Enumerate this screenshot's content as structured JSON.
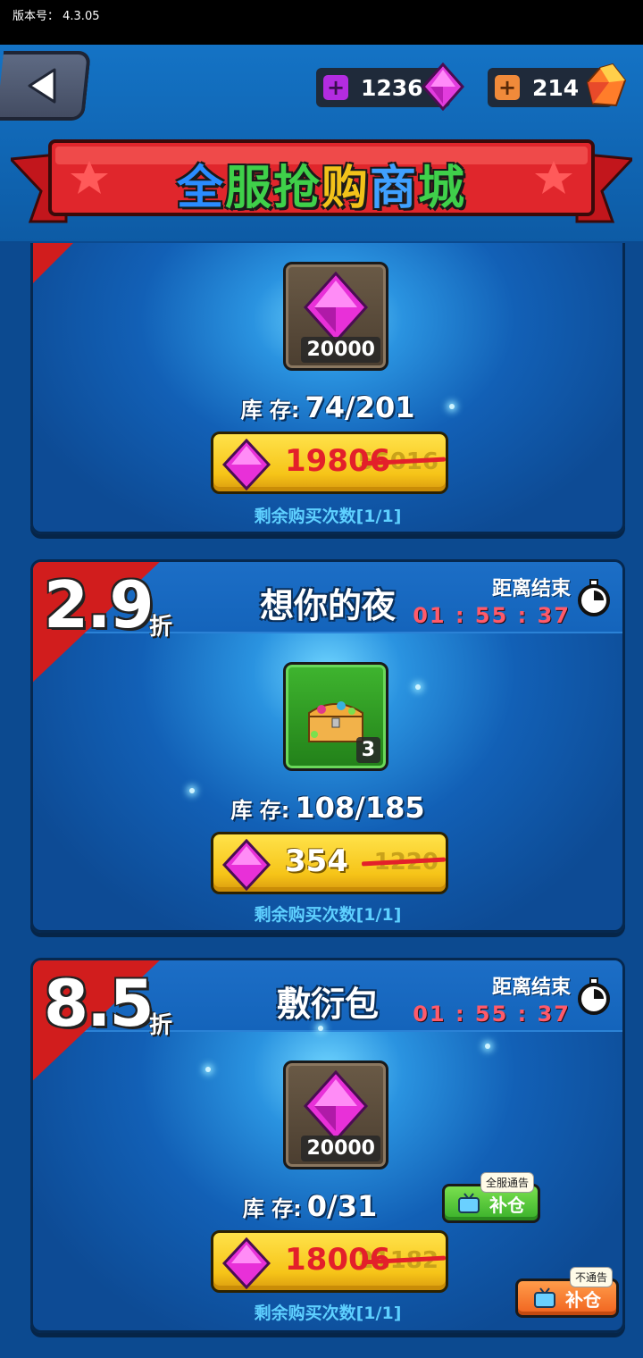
{
  "status_bar": {
    "version_text": "版本号： 4.3.05"
  },
  "header": {
    "back_icon": "back-arrow-icon",
    "gems": {
      "value": "1236",
      "icon": "purple-gem-icon"
    },
    "crystals": {
      "value": "214",
      "icon": "orange-crystal-icon"
    }
  },
  "banner": {
    "title_chars": [
      "全",
      "服",
      "抢",
      "购",
      "商",
      "城"
    ]
  },
  "colors": {
    "banner_red": "#e0262c",
    "title_char_colors": [
      "#2a8cff",
      "#3fd04a",
      "#3fd04a",
      "#f2c21a",
      "#3fa0ff",
      "#3fd04a"
    ],
    "timer_red": "#ff5a6a",
    "price_red": "#e3202a",
    "remain_blue": "#5ed0ff"
  },
  "cards": [
    {
      "item_icon": "pink-gem-icon",
      "item_count": "20000",
      "stock_label": "库 存:",
      "stock_value": "74/201",
      "price": "19806",
      "original_price": "55016",
      "remain_text": "剩余购买次数[1/1]"
    },
    {
      "discount": "2.9",
      "discount_suffix": "折",
      "title": "想你的夜",
      "timer_label": "距离结束",
      "timer_value": "01 : 55 : 37",
      "item_icon": "treasure-chest-icon",
      "item_count": "3",
      "stock_label": "库 存:",
      "stock_value": "108/185",
      "price": "354",
      "original_price": "1220",
      "remain_text": "剩余购买次数[1/1]"
    },
    {
      "discount": "8.5",
      "discount_suffix": "折",
      "title": "敷衍包",
      "timer_label": "距离结束",
      "timer_value": "01 : 55 : 37",
      "item_icon": "pink-gem-icon",
      "item_count": "20000",
      "stock_label": "库 存:",
      "stock_value": "0/31",
      "price": "18006",
      "original_price": "21182",
      "remain_text": "剩余购买次数[1/1]",
      "restock_server": {
        "label": "补仓",
        "tag": "全服通告",
        "icon": "tv-icon"
      },
      "restock_private": {
        "label": "补仓",
        "tag": "不通告",
        "icon": "tv-icon"
      }
    }
  ]
}
